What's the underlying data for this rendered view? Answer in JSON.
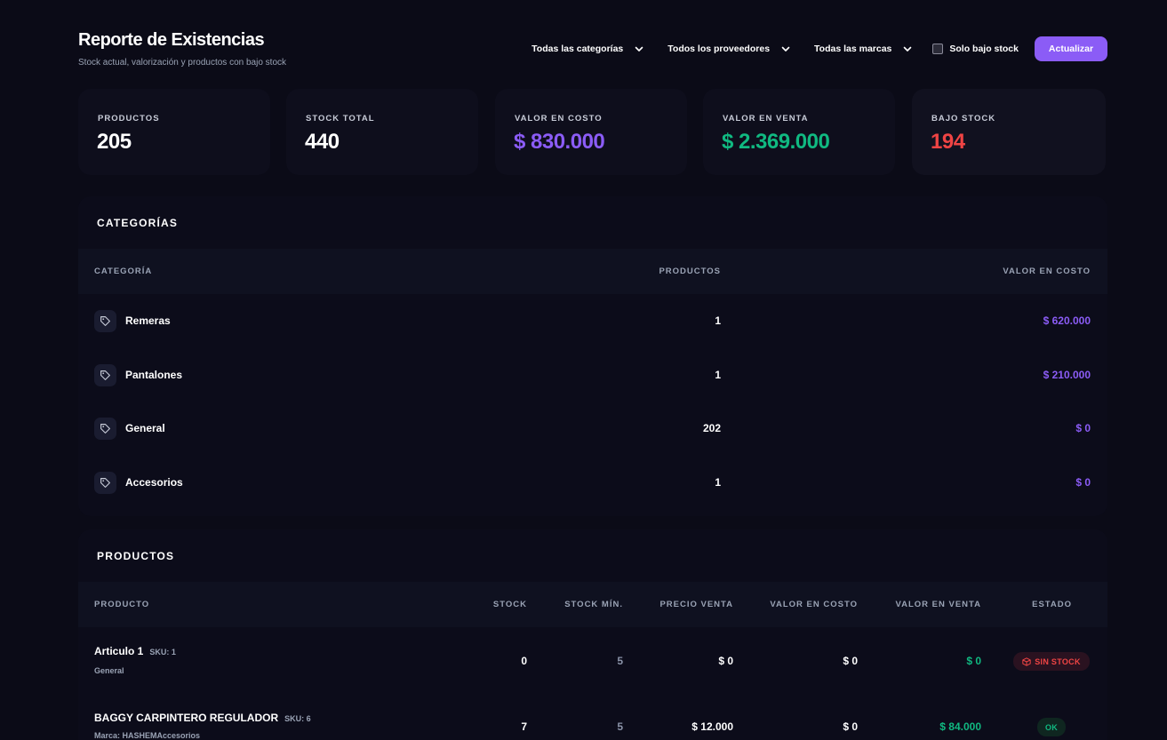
{
  "header": {
    "title": "Reporte de Existencias",
    "subtitle": "Stock actual, valorización y productos con bajo stock"
  },
  "filters": {
    "category": "Todas las categorías",
    "supplier": "Todos los proveedores",
    "brand": "Todas las marcas",
    "low_stock_label": "Solo bajo stock",
    "update_label": "Actualizar"
  },
  "stats": [
    {
      "label": "PRODUCTOS",
      "value": "205",
      "color": "#ffffff"
    },
    {
      "label": "STOCK TOTAL",
      "value": "440",
      "color": "#ffffff"
    },
    {
      "label": "VALOR EN COSTO",
      "value": "$ 830.000",
      "color": "#8b5cf6"
    },
    {
      "label": "VALOR EN VENTA",
      "value": "$ 2.369.000",
      "color": "#10b981"
    },
    {
      "label": "BAJO STOCK",
      "value": "194",
      "color": "#ef4444"
    }
  ],
  "categories": {
    "title": "CATEGORÍAS",
    "headers": {
      "category": "CATEGORÍA",
      "products": "PRODUCTOS",
      "cost": "VALOR EN COSTO"
    },
    "rows": [
      {
        "name": "Remeras",
        "products": "1",
        "cost": "$ 620.000"
      },
      {
        "name": "Pantalones",
        "products": "1",
        "cost": "$ 210.000"
      },
      {
        "name": "General",
        "products": "202",
        "cost": "$ 0"
      },
      {
        "name": "Accesorios",
        "products": "1",
        "cost": "$ 0"
      }
    ]
  },
  "products": {
    "title": "PRODUCTOS",
    "headers": {
      "product": "PRODUCTO",
      "stock": "STOCK",
      "min_stock": "STOCK MÍN.",
      "sale_price": "PRECIO VENTA",
      "cost_value": "VALOR EN COSTO",
      "sale_value": "VALOR EN VENTA",
      "status": "ESTADO"
    },
    "rows": [
      {
        "name": "Articulo 1",
        "sku": "SKU: 1",
        "sub": "General",
        "stock": "0",
        "min_stock": "5",
        "sale_price": "$ 0",
        "cost_value": "$ 0",
        "sale_value": "$ 0",
        "status": "SIN STOCK"
      },
      {
        "name": "BAGGY CARPINTERO REGULADOR",
        "sku": "SKU: 6",
        "sub": "Marca: HASHEMAccesorios",
        "stock": "7",
        "min_stock": "5",
        "sale_price": "$ 12.000",
        "cost_value": "$ 0",
        "sale_value": "$ 84.000",
        "status": "OK"
      }
    ]
  },
  "colors": {
    "accent": "#8b5cf6",
    "success": "#10b981",
    "danger": "#ef4444",
    "background": "#0b0b17"
  }
}
